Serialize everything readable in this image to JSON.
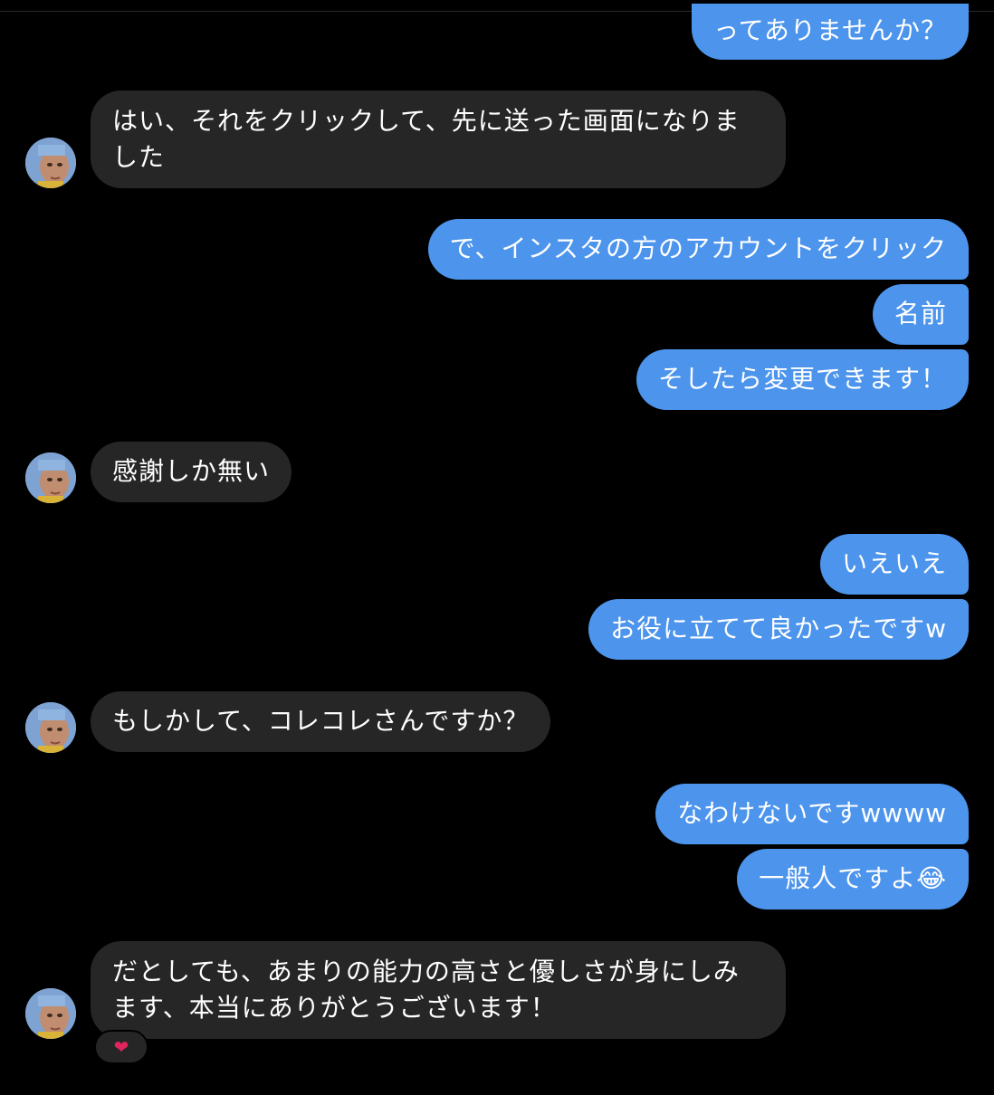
{
  "messages": {
    "m1": "ってありませんか？",
    "m2": "はい、それをクリックして、先に送った画面になりました",
    "m3": "で、インスタの方のアカウントをクリック",
    "m4": "名前",
    "m5": "そしたら変更できます！",
    "m6": "感謝しか無い",
    "m7": "いえいえ",
    "m8": "お役に立てて良かったですw",
    "m9": "もしかして、コレコレさんですか？",
    "m10": "なわけないですwwww",
    "m11": "一般人ですよ😂",
    "m12": "だとしても、あまりの能力の高さと優しさが身にしみます、本当にありがとうございます！"
  },
  "reaction": "❤",
  "colors": {
    "background": "#000000",
    "sent_bubble": "#4c94ec",
    "received_bubble": "#262626",
    "text": "#ffffff",
    "reaction_heart": "#e0245e"
  },
  "icons": {
    "avatar": "avatar-icon",
    "reaction": "heart-reaction-icon"
  }
}
